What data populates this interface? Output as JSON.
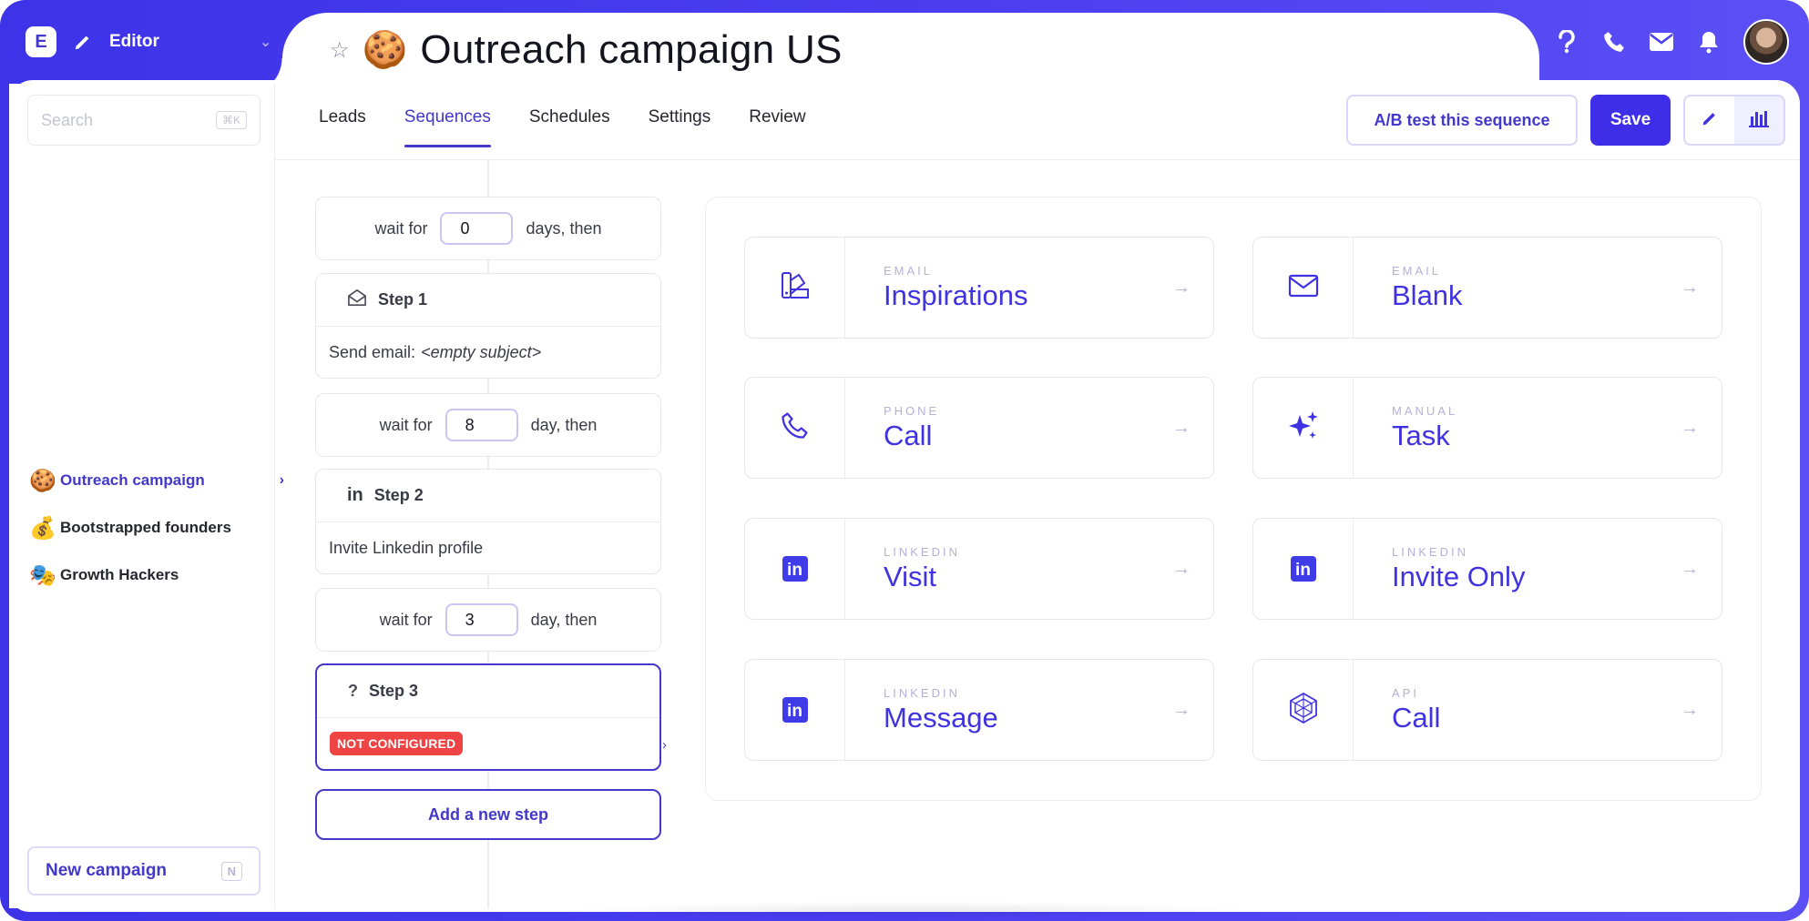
{
  "header": {
    "editor_label": "Editor",
    "page_title": "Outreach campaign US",
    "title_emoji": "🍪"
  },
  "sidebar": {
    "search_placeholder": "Search",
    "search_shortcut": "⌘K",
    "campaigns": [
      {
        "emoji": "🍪",
        "label": "Outreach campaign",
        "active": true
      },
      {
        "emoji": "💰",
        "label": "Bootstrapped founders",
        "active": false
      },
      {
        "emoji": "🎭",
        "label": "Growth Hackers",
        "active": false
      }
    ],
    "new_campaign_label": "New campaign",
    "new_campaign_shortcut": "N"
  },
  "tabs": [
    {
      "label": "Leads",
      "active": false
    },
    {
      "label": "Sequences",
      "active": true
    },
    {
      "label": "Schedules",
      "active": false
    },
    {
      "label": "Settings",
      "active": false
    },
    {
      "label": "Review",
      "active": false
    }
  ],
  "toolbar": {
    "ab_test_label": "A/B test this sequence",
    "save_label": "Save"
  },
  "sequence": {
    "waits": [
      {
        "prefix": "wait for",
        "value": "0",
        "suffix": "days, then"
      },
      {
        "prefix": "wait for",
        "value": "8",
        "suffix": "day, then"
      },
      {
        "prefix": "wait for",
        "value": "3",
        "suffix": "day, then"
      }
    ],
    "steps": [
      {
        "label": "Step 1",
        "icon": "mail-open-icon",
        "body": "Send email:",
        "body_em": "<empty subject>"
      },
      {
        "label": "Step 2",
        "icon": "linkedin-icon",
        "body": "Invite Linkedin profile"
      },
      {
        "label": "Step 3",
        "icon": "question-icon",
        "badge": "NOT CONFIGURED"
      }
    ],
    "add_step_label": "Add a new step"
  },
  "options": [
    {
      "category": "EMAIL",
      "name": "Inspirations",
      "icon": "palette-icon"
    },
    {
      "category": "EMAIL",
      "name": "Blank",
      "icon": "envelope-icon"
    },
    {
      "category": "PHONE",
      "name": "Call",
      "icon": "phone-icon"
    },
    {
      "category": "MANUAL",
      "name": "Task",
      "icon": "sparkles-icon"
    },
    {
      "category": "LINKEDIN",
      "name": "Visit",
      "icon": "linkedin-icon"
    },
    {
      "category": "LINKEDIN",
      "name": "Invite Only",
      "icon": "linkedin-icon"
    },
    {
      "category": "LINKEDIN",
      "name": "Message",
      "icon": "linkedin-icon"
    },
    {
      "category": "API",
      "name": "Call",
      "icon": "api-hexagon-icon"
    }
  ],
  "colors": {
    "accent": "#4338ca",
    "frame": "#4a3df0",
    "danger": "#ef4444"
  }
}
